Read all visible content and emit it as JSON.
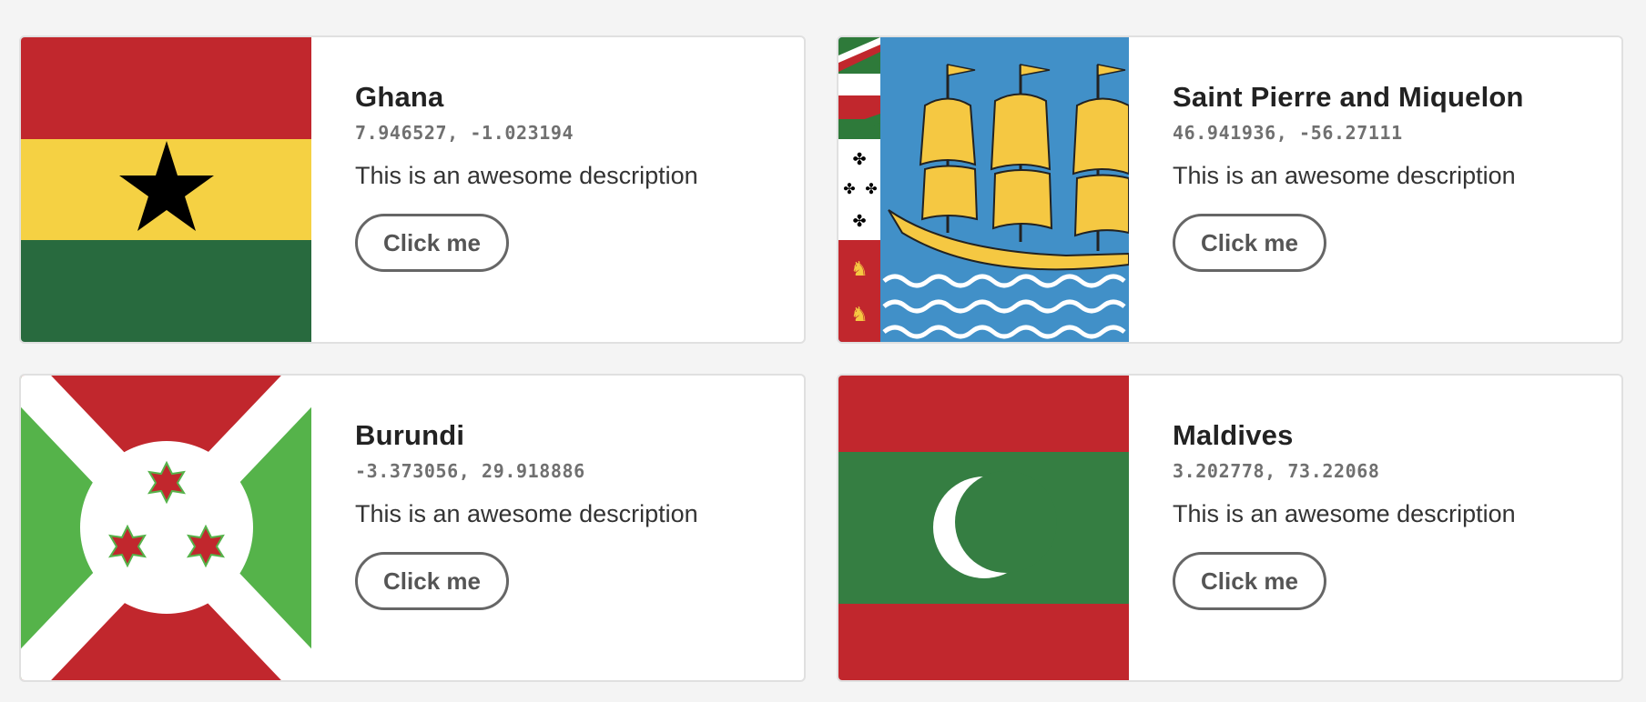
{
  "cards": [
    {
      "country": "Ghana",
      "coordinates": "7.946527, -1.023194",
      "description": "This is an awesome description",
      "button_label": "Click me",
      "flag_icon": "ghana-flag-icon"
    },
    {
      "country": "Saint Pierre and Miquelon",
      "coordinates": "46.941936, -56.27111",
      "description": "This is an awesome description",
      "button_label": "Click me",
      "flag_icon": "saint-pierre-and-miquelon-flag-icon"
    },
    {
      "country": "Burundi",
      "coordinates": "-3.373056, 29.918886",
      "description": "This is an awesome description",
      "button_label": "Click me",
      "flag_icon": "burundi-flag-icon"
    },
    {
      "country": "Maldives",
      "coordinates": "3.202778, 73.22068",
      "description": "This is an awesome description",
      "button_label": "Click me",
      "flag_icon": "maldives-flag-icon"
    }
  ],
  "colors": {
    "page_background": "#f4f4f4",
    "card_background": "#ffffff",
    "card_border": "#e0e0e0",
    "title_text": "#222222",
    "coordinates_text": "#707070",
    "button_border": "#666666"
  }
}
